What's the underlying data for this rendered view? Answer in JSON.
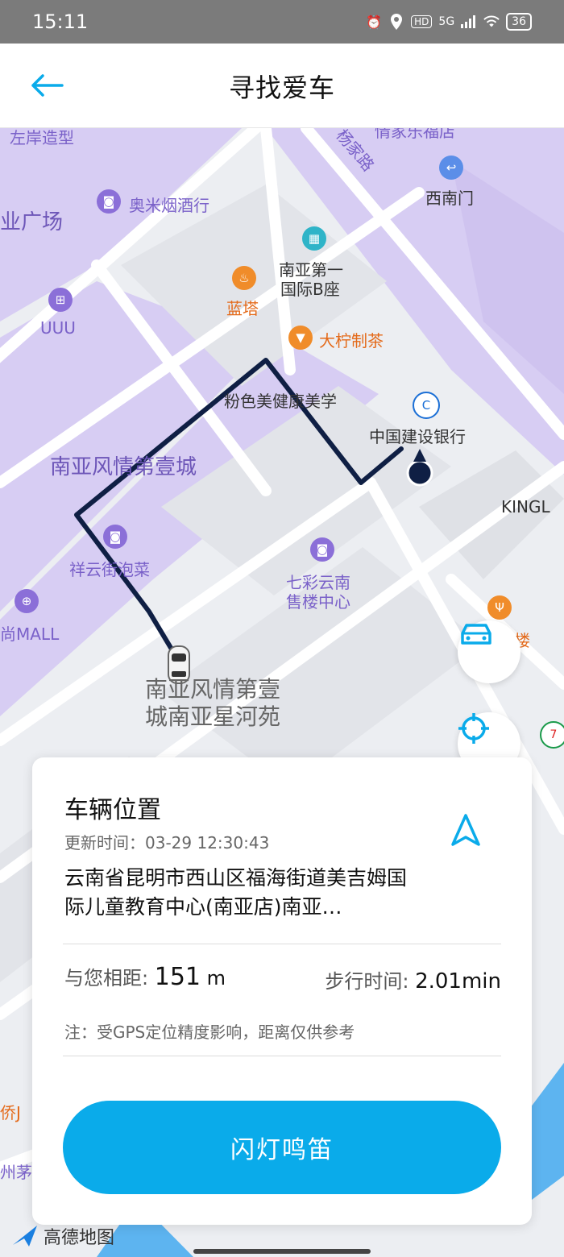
{
  "status_bar": {
    "time": "15:11",
    "network": "5G",
    "hd": "HD",
    "battery": "36"
  },
  "header": {
    "title": "寻找爱车"
  },
  "map": {
    "pois": {
      "zuoan": "左岸造型",
      "yangjia": "杨家路",
      "qingjia": "情家乐福店",
      "aomi": "奥米烟酒行",
      "xinanmen": "西南门",
      "guangchang": "业广场",
      "nanya1": "南亚第一",
      "nanya1b": "国际B座",
      "lanta": "蓝塔",
      "uuu": "UUU",
      "daning": "大柠制茶",
      "fense": "粉色美健康美学",
      "ccb": "中国建设银行",
      "nanya_city": "南亚风情第壹城",
      "kingl": "KINGL",
      "xiangyun": "祥云街泡菜",
      "qicai1": "七彩云南",
      "qicai2": "售楼中心",
      "mall": "尚MALL",
      "dest1": "南亚风情第壹",
      "dest2": "城南亚星河苑",
      "edge1": "侨J",
      "edge2": "州茅",
      "edge3": "楼"
    },
    "accent_color": "#0aabea",
    "route_color": "#0f1f44"
  },
  "card": {
    "title": "车辆位置",
    "update_label": "更新时间：",
    "update_time": "03-29 12:30:43",
    "address": "云南省昆明市西山区福海街道美吉姆国际儿童教育中心(南亚店)南亚…",
    "distance_label": "与您相距:",
    "distance_value": "151",
    "distance_unit": "m",
    "walk_label": "步行时间:",
    "walk_value": "2.01min",
    "note": "注：受GPS定位精度影响，距离仅供参考",
    "action_label": "闪灯鸣笛"
  },
  "logo": {
    "text": "高德地图"
  }
}
